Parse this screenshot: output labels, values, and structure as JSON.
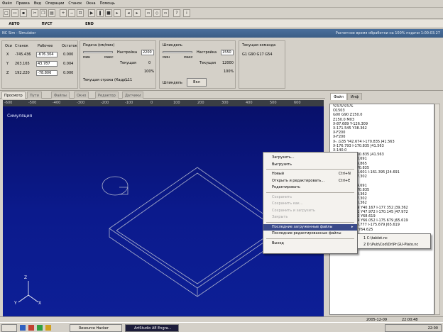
{
  "menu": [
    "Файл",
    "Правка",
    "Вид",
    "Операции",
    "Станок",
    "Окна",
    "Помощь"
  ],
  "mode_buttons": [
    "АВТО",
    "ПУСТ",
    "END"
  ],
  "title": {
    "left": "NC Sim - Simulator",
    "right": "Расчетное время обработки на 100% подачи 1:00:03.27"
  },
  "coords": {
    "headers": [
      "Оси",
      "Станок",
      "Рабочее",
      "Остаток"
    ],
    "rows": [
      {
        "axis": "X",
        "machine": "-745.436",
        "work": "-676.304",
        "rest": "0.000"
      },
      {
        "axis": "Y",
        "machine": "263.165",
        "work": "43.787",
        "rest": "0.004"
      },
      {
        "axis": "Z",
        "machine": "192.220",
        "work": "-78.806",
        "rest": "0.000"
      }
    ]
  },
  "feed": {
    "title": "Подача (мм/мин)",
    "setting_label": "Настройка",
    "setting_value": "2200",
    "min_label": "мин",
    "max_label": "макс",
    "current_label": "Текущая",
    "current_value": "0",
    "percent": "100%",
    "line_label": "Текущая строка (Кадр):",
    "line_value": "L11"
  },
  "spindle": {
    "title": "Шпиндель",
    "setting_label": "Настройка",
    "setting_value": "1550",
    "min_label": "мин",
    "max_label": "макс",
    "current_label": "Текущая",
    "current_value": "12000",
    "percent": "100%",
    "spindle_label": "Шпиндель",
    "button": "Вкл"
  },
  "current_command": {
    "title": "Текущая команда",
    "value": "G1 G90 G17 G54"
  },
  "view_tabs": [
    "Просмотр",
    "Пути",
    "Файлы",
    "Окно",
    "Редактор",
    "Датчики"
  ],
  "ruler": [
    "-600",
    "-500",
    "-400",
    "-300",
    "-200",
    "-100",
    "0",
    "100",
    "200",
    "300",
    "400",
    "500",
    "600"
  ],
  "viewport_label": "Симуляция",
  "axis_labels": {
    "x": "X",
    "y": "Y",
    "z": "Z"
  },
  "right_tabs": [
    "Файл",
    "Инф"
  ],
  "code_lines": [
    "%%%%%%",
    "O1503",
    "G00 G90 Z150.0",
    "Z150.0 M03",
    "X-87.689 Y-126.309",
    "X-171.545 Y38.362",
    "X-F200",
    "X-F200",
    "X-..G35 Y42.674 I-170.835 J41.563",
    "X-176.793 I-170.835 J41.563",
    "X-140.0",
    "X-176.793 I-170.835 J41.563",
    "X-175.150 Y40.691",
    "X-176.793 Y39.865",
    "X-170.140 J-170.835",
    "X-170.825 Y35.601 I-161.395 J24.691",
    "X-175.150 Y37.302",
    "X-163.9",
    "X-175.150 Y34.691",
    "X-176.793 I-170.835",
    "X-171.545 Y38.362",
    "X-176.793 Y37.302",
    "X-170.835 Y36.362",
    "G02 X-173.749 Y40.167 I-177.352 J39.362",
    "G01 X-176.151 Y47.972 I-170.145 J47.972",
    "G01 X-176.152 Y68.619",
    "G02 X-175.679 Y66.052 I-175.679 J65.619",
    "X-175.222 Y65.777 I-175.679 J65.619",
    "G01 X-174.79 Y64.625"
  ],
  "context_menu": [
    {
      "label": "Загрузить...",
      "shortcut": "",
      "disabled": false
    },
    {
      "label": "Выгрузить",
      "shortcut": "",
      "disabled": false
    },
    {
      "label": "Новый",
      "shortcut": "Ctrl+N",
      "disabled": false
    },
    {
      "label": "Открыть и редактировать...",
      "shortcut": "Ctrl+E",
      "disabled": false
    },
    {
      "label": "Редактировать",
      "shortcut": "",
      "disabled": false
    },
    {
      "label": "Сохранить",
      "shortcut": "",
      "disabled": true
    },
    {
      "label": "Сохранить как...",
      "shortcut": "",
      "disabled": true
    },
    {
      "label": "Сохранить и загрузить",
      "shortcut": "",
      "disabled": true
    },
    {
      "label": "Закрыть",
      "shortcut": "",
      "disabled": true
    },
    {
      "label": "Последние загруженные файлы",
      "shortcut": "",
      "disabled": false,
      "highlighted": true
    },
    {
      "label": "Последние редактированные файлы",
      "shortcut": "",
      "disabled": false
    },
    {
      "label": "Выход",
      "shortcut": "",
      "disabled": false
    }
  ],
  "submenu": [
    "1 C:\\tablet.nc",
    "2 D:\\Pub\\Cod\\Dr\\Pr.GU-Plato.nc"
  ],
  "status": {
    "date": "2005-12-09",
    "time": "22:00:48"
  },
  "taskbar": {
    "tasks": [
      {
        "label": "Resource Hacker",
        "active": false
      },
      {
        "label": "ArtStudio AE Engra...",
        "active": true
      }
    ],
    "clock": "22:00"
  }
}
